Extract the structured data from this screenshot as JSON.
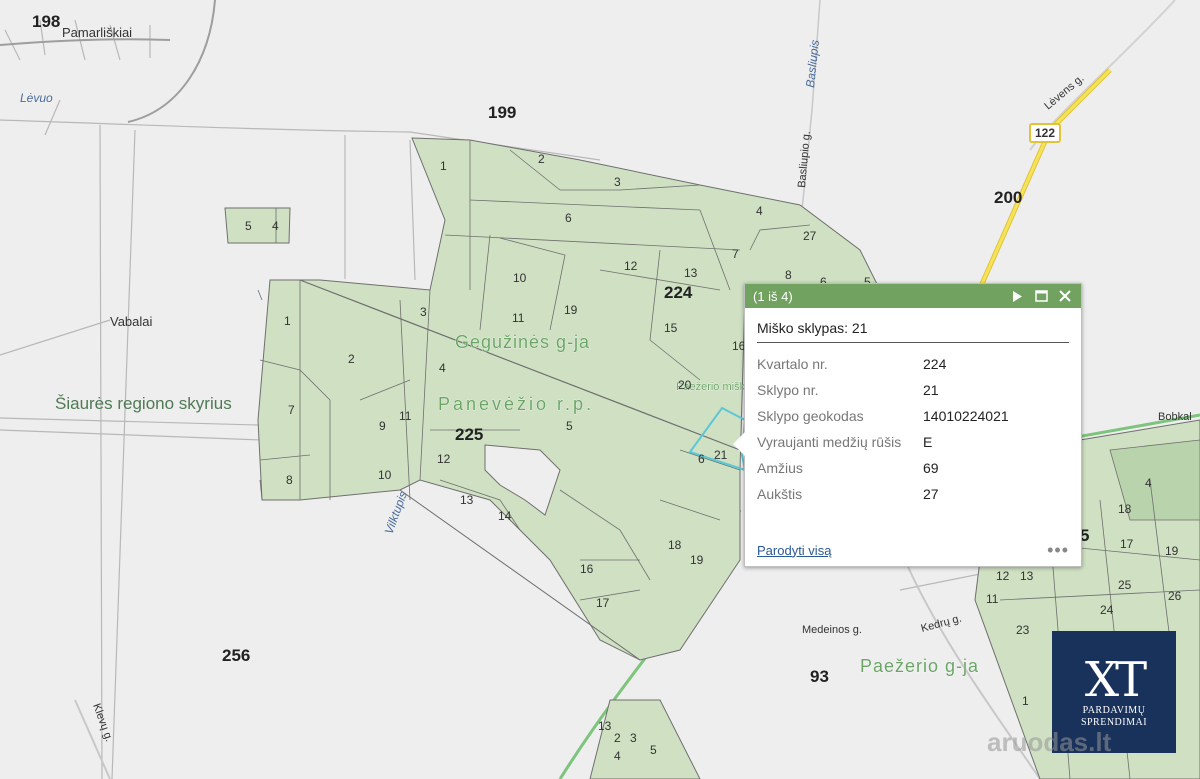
{
  "map": {
    "block_numbers": [
      "198",
      "199",
      "200",
      "224",
      "225",
      "256",
      "93"
    ],
    "place_labels": [
      "Pamarliškiai",
      "Vabalai",
      "Šiaurės regiono skyrius",
      "Bobkal"
    ],
    "water_labels": [
      "Lėvuo",
      "Basliupis",
      "Vilktupis"
    ],
    "street_labels": [
      "Basliupio g.",
      "Lėvens g.",
      "Medeinos g.",
      "Kedrų g.",
      "Klevų g."
    ],
    "road_shield": "122",
    "forest_labels": [
      "Gegužinės g-ja",
      "Panevėžio r.p.",
      "Paežerio g-ja",
      "Paežerio miškas"
    ],
    "parcel_numbers_main": [
      "1",
      "2",
      "3",
      "4",
      "5",
      "6",
      "7",
      "8",
      "9",
      "10",
      "11",
      "12",
      "13",
      "14",
      "15",
      "16",
      "17",
      "18",
      "19",
      "21",
      "27"
    ],
    "colors": {
      "forest": "#cfe0c3",
      "background": "#eeeeee",
      "road": "#f2d94a",
      "selection": "#5bc8d7"
    }
  },
  "popup": {
    "count": "(1 iš 4)",
    "title": "Miško sklypas: 21",
    "attributes": [
      {
        "key": "Kvartalo nr.",
        "value": "224"
      },
      {
        "key": "Sklypo nr.",
        "value": "21"
      },
      {
        "key": "Sklypo geokodas",
        "value": "14010224021"
      },
      {
        "key": "Vyraujanti medžių rūšis",
        "value": "E"
      },
      {
        "key": "Amžius",
        "value": "69"
      },
      {
        "key": "Aukštis",
        "value": "27"
      }
    ],
    "show_all": "Parodyti visą",
    "more": "•••",
    "icons": [
      "play-icon",
      "maximize-icon",
      "close-icon"
    ]
  },
  "logo": {
    "big": "XT",
    "line1": "PARDAVIMŲ",
    "line2": "SPRENDIMAI"
  },
  "watermark": "aruodas.lt"
}
